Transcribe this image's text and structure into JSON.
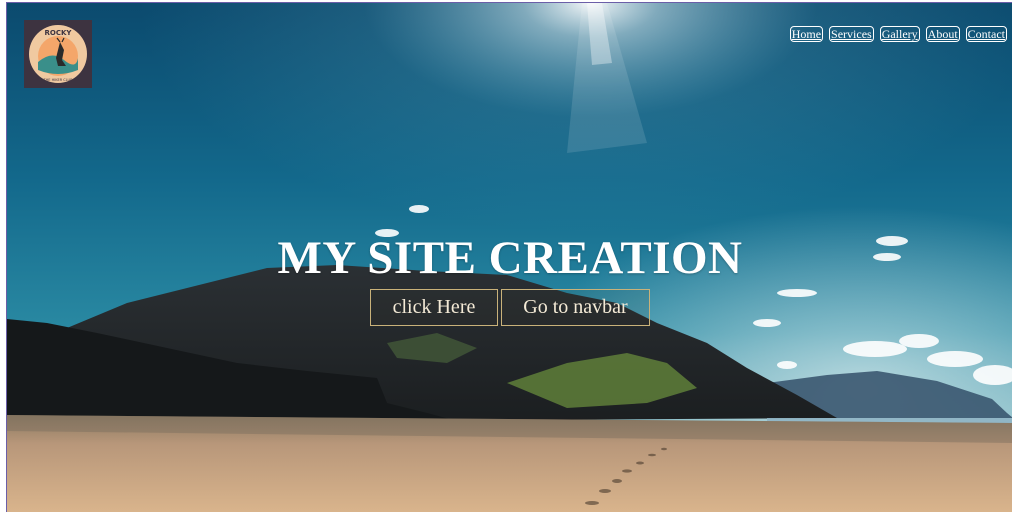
{
  "logo": {
    "top_text": "ROCKY",
    "bottom_text": "THE HIKER CLUB",
    "colors": {
      "bg": "#3d3340",
      "ring": "#f0c9a0",
      "sun": "#f4a66a",
      "land": "#3a8f8a"
    }
  },
  "nav": {
    "items": [
      {
        "label": "Home"
      },
      {
        "label": "Services"
      },
      {
        "label": "Gallery"
      },
      {
        "label": "About"
      },
      {
        "label": "Contact"
      }
    ]
  },
  "hero": {
    "title": "MY SITE CREATION",
    "buttons": [
      {
        "label": "click Here"
      },
      {
        "label": "Go to navbar"
      }
    ]
  },
  "colors": {
    "sky_top": "#0c4f73",
    "sky_mid": "#1f7a99",
    "sand": "#c9a57a",
    "button_border": "#c9b27a"
  }
}
